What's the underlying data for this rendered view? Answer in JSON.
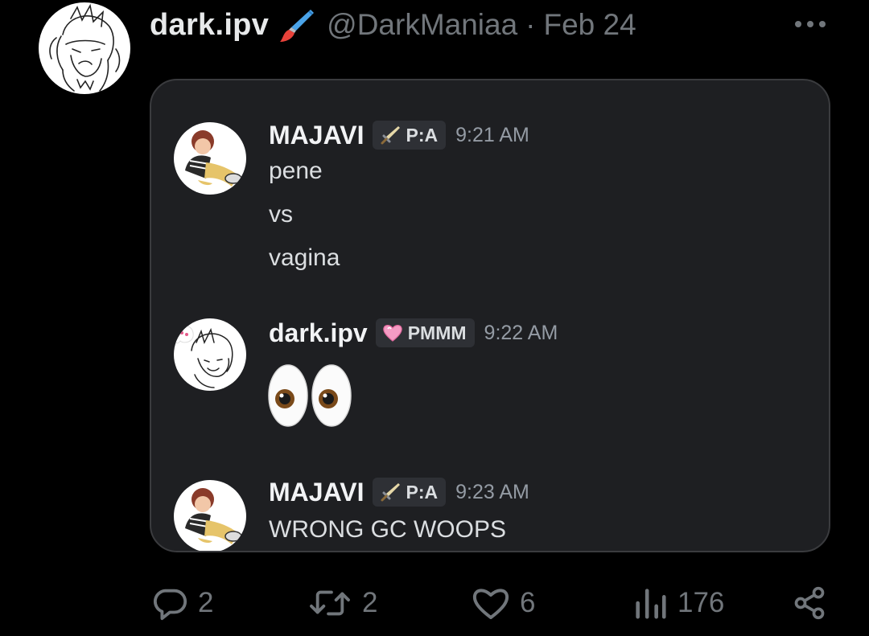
{
  "tweet": {
    "author_name": "dark.ipv",
    "author_badge_icon": "paintbrush-icon",
    "handle": "@DarkManiaa",
    "separator": "·",
    "date": "Feb 24"
  },
  "embedded_chat": {
    "messages": [
      {
        "user": "MAJAVI",
        "role_icon": "sword-icon",
        "role": "P:A",
        "time": "9:21 AM",
        "lines": [
          "pene",
          "vs",
          "vagina"
        ]
      },
      {
        "user": "dark.ipv",
        "role_icon": "pink-heart-icon",
        "role": "PMMM",
        "time": "9:22 AM",
        "emoji": "eyes-emoji"
      },
      {
        "user": "MAJAVI",
        "role_icon": "sword-icon",
        "role": "P:A",
        "time": "9:23 AM",
        "lines": [
          "WRONG GC WOOPS"
        ]
      }
    ]
  },
  "actions": {
    "replies": "2",
    "reposts": "2",
    "likes": "6",
    "views": "176"
  },
  "colors": {
    "background": "#000000",
    "card": "#1e1f22",
    "muted": "#71767b",
    "role_tag": "#2e3035"
  }
}
